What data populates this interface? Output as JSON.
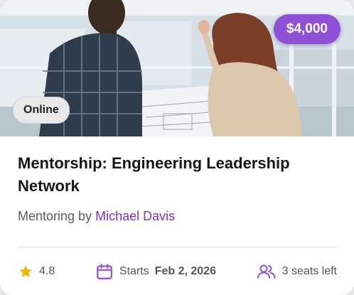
{
  "card": {
    "price": "$4,000",
    "mode": "Online",
    "title": "Mentorship: Engineering Leadership Network",
    "mentor_prefix": "Mentoring by",
    "mentor_name": "Michael Davis",
    "rating": "4.8",
    "starts_label": "Starts",
    "starts_date": "Feb 2, 2026",
    "seats": "3 seats left"
  },
  "icons": {
    "rating": "star-icon",
    "date": "calendar-icon",
    "seats": "people-icon"
  },
  "colors": {
    "accent": "#8f4fd6",
    "mentor_link": "#7a34c4",
    "star": "#f2b705"
  }
}
